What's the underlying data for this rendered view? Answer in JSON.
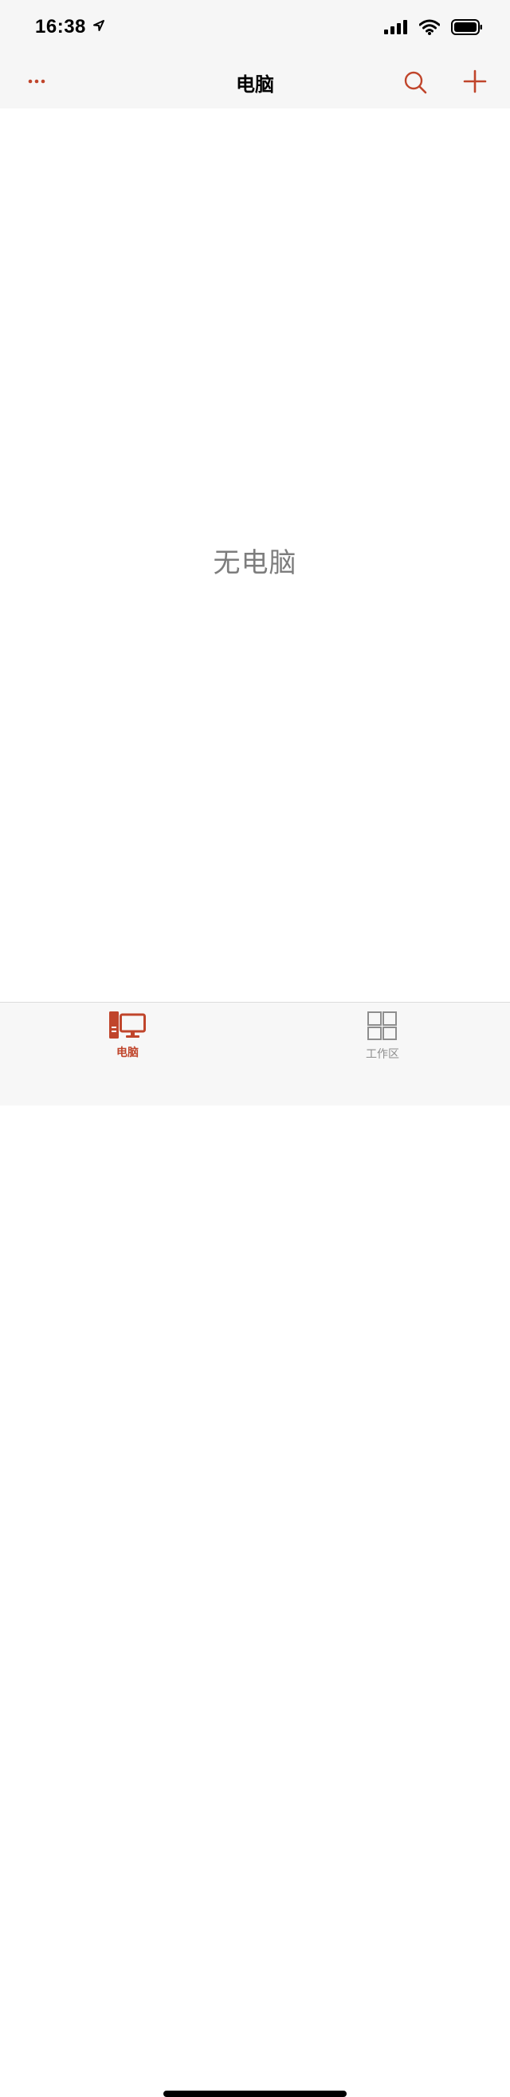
{
  "status_bar": {
    "time": "16:38"
  },
  "nav": {
    "title": "电脑"
  },
  "main": {
    "empty_message": "无电脑"
  },
  "tabs": [
    {
      "label": "电脑",
      "active": true
    },
    {
      "label": "工作区",
      "active": false
    }
  ],
  "colors": {
    "accent": "#c0452b",
    "inactive": "#8e8e8e",
    "bar_background": "#f6f6f6",
    "empty_text": "#7d7d7d"
  },
  "icons": {
    "more": "ellipsis-icon",
    "search": "search-icon",
    "add": "plus-icon",
    "computer_tab": "desktop-computer-icon",
    "workspace_tab": "grid-icon"
  }
}
